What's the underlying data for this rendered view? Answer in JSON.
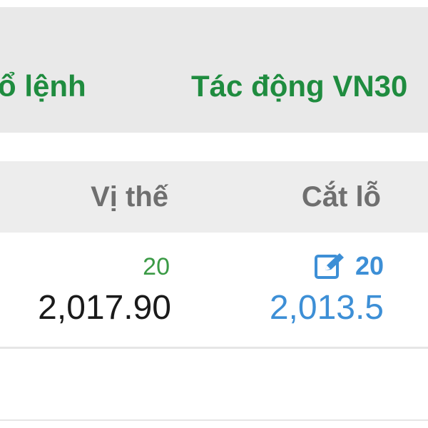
{
  "tabs": {
    "left_label": "ổ lệnh",
    "right_label": "Tác động VN30"
  },
  "columns": {
    "position_header": "Vị thế",
    "stoploss_header": "Cắt lỗ"
  },
  "row": {
    "position_qty": "20",
    "position_price": "2,017.90",
    "stoploss_qty": "20",
    "stoploss_price": "2,013.5"
  },
  "icons": {
    "edit": "edit-icon"
  },
  "colors": {
    "tab_text": "#1f8c3f",
    "header_text": "#6f6f6f",
    "qty_green": "#3a9a45",
    "accent_blue": "#3d8fd6",
    "price_text": "#1a1a1a"
  }
}
